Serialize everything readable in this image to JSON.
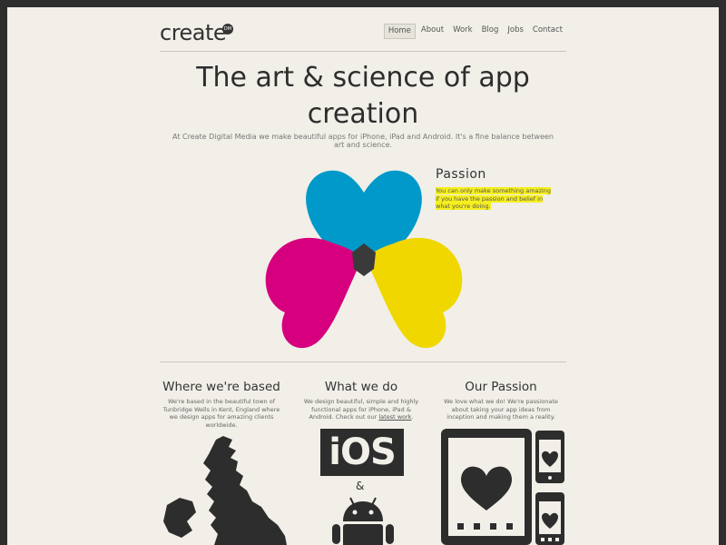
{
  "header": {
    "logo_text": "create",
    "logo_badge": "DM",
    "nav": [
      {
        "label": "Home",
        "active": true
      },
      {
        "label": "About",
        "active": false
      },
      {
        "label": "Work",
        "active": false
      },
      {
        "label": "Blog",
        "active": false
      },
      {
        "label": "Jobs",
        "active": false
      },
      {
        "label": "Contact",
        "active": false
      }
    ]
  },
  "hero": {
    "title_line1": "The art & science of app",
    "title_line2": "creation",
    "subtitle_line1": "At Create Digital Media we make beautiful apps for iPhone, iPad and Android. It's a fine balance between",
    "subtitle_line2": "art and science."
  },
  "hearts_colors": {
    "cyan": "#00a3dd",
    "magenta": "#e3008c",
    "yellow": "#ffe600",
    "center": "#3a3a3a"
  },
  "passion": {
    "title": "Passion",
    "text_line1": "You can only make something amazing",
    "text_line2": "if you have the passion and belief in",
    "text_line3": "what you're doing."
  },
  "columns": [
    {
      "title": "Where we're based",
      "lines": [
        "We're based in the beautiful town of",
        "Tunbridge Wells in Kent, England where",
        "we design apps for amazing clients",
        "worldwide."
      ]
    },
    {
      "title": "What we do",
      "lines": [
        "We design beautiful, simple and highly",
        "functional apps for iPhone, iPad &",
        "Android. Check out our "
      ],
      "link": "latest work",
      "link_suffix": "."
    },
    {
      "title": "Our Passion",
      "lines": [
        "We love what we do! We're passionate",
        "about taking your app ideas from",
        "inception and making them a reality."
      ]
    }
  ],
  "graphics": {
    "ios_label": "iOS",
    "amp": "&"
  }
}
